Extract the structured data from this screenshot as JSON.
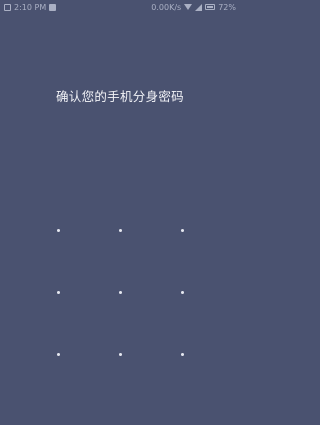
{
  "status_bar": {
    "time": "2:10 PM",
    "network_speed": "0.00K/s",
    "battery": "72%"
  },
  "lock_screen": {
    "prompt": "确认您的手机分身密码",
    "pattern_dots": 9
  }
}
